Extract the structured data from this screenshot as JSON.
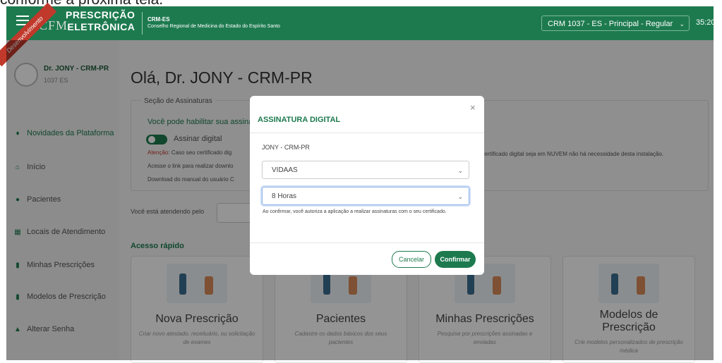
{
  "caption": "conforme a próxima tela.",
  "header": {
    "logo_small": "CFM",
    "logo_line1": "PRESCRIÇÃO",
    "logo_line2": "ELETRÔNICA",
    "org_short": "CRM-ES",
    "org_full": "Conselho Regional de Medicina do Estado do Espírito Santo",
    "crm_select": "CRM 1037 - ES - Principal - Regular",
    "timer": "35:20",
    "ribbon": "Desenvolvimento"
  },
  "user": {
    "name": "Dr. JONY - CRM-PR",
    "code": "1037 ES"
  },
  "sidebar": {
    "items": [
      {
        "label": "Novidades da Plataforma",
        "icon": "bell-icon"
      },
      {
        "label": "Início",
        "icon": "home-icon"
      },
      {
        "label": "Pacientes",
        "icon": "user-icon"
      },
      {
        "label": "Locais de Atendimento",
        "icon": "building-icon"
      },
      {
        "label": "Minhas Prescrições",
        "icon": "file-icon"
      },
      {
        "label": "Modelos de Prescrição",
        "icon": "file-text-icon"
      },
      {
        "label": "Alterar Senha",
        "icon": "lock-icon"
      }
    ]
  },
  "main": {
    "greeting": "Olá, Dr. JONY - CRM-PR",
    "section_title": "Seção de Assinaturas",
    "section_text": "Você pode habilitar sua assina",
    "toggle_label": "Assinar digital",
    "atencao_label": "Atenção:",
    "atencao_text": "Caso seu certificado dig",
    "line1": "Acesse o link para realizar downlo",
    "line2": "Download do manual do usuário C",
    "right_note": "certificado digital seja em NUVEM não há necessidade desta instalação.",
    "atendendo": "Você está atendendo pelo",
    "acesso_rapido": "Acesso rápido",
    "cards": [
      {
        "title": "Nova Prescrição",
        "desc": "Criar novo atestado, receituário, ou solicitação de exames"
      },
      {
        "title": "Pacientes",
        "desc": "Cadastre os dados básicos dos seus pacientes"
      },
      {
        "title": "Minhas Prescrições",
        "desc": "Pesquise por prescrições assinadas e enviadas"
      },
      {
        "title": "Modelos de Prescrição",
        "desc": "Crie modelos personalizados de prescrição médica"
      }
    ]
  },
  "modal": {
    "title": "ASSINATURA DIGITAL",
    "close": "×",
    "user": "JONY - CRM-PR",
    "provider": "VIDAAS",
    "duration": "8 Horas",
    "note": "Ao confirmar, você autoriza a aplicação a realizar assinaturas com o seu certificado.",
    "cancel": "Cancelar",
    "confirm": "Confirmar"
  },
  "colors": {
    "brand": "#1d7a4f",
    "ribbon": "#c0392b"
  }
}
